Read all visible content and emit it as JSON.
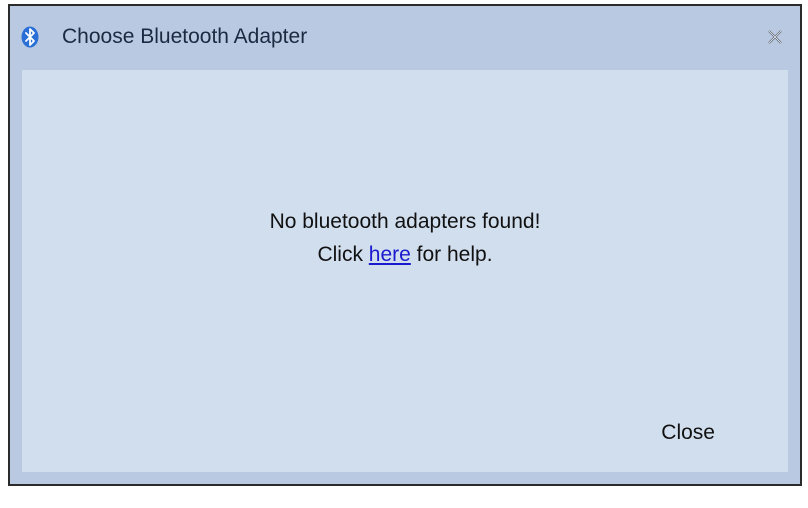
{
  "window": {
    "title": "Choose Bluetooth Adapter",
    "title_icon": "bluetooth-icon",
    "close_icon": "close-icon"
  },
  "message": {
    "line1": "No bluetooth adapters found!",
    "line2_prefix": "Click ",
    "link_text": "here",
    "line2_suffix": " for help."
  },
  "buttons": {
    "close_label": "Close"
  },
  "colors": {
    "frame": "#b9c9e2",
    "client": "#d1deee",
    "link": "#1a1acf",
    "bluetooth_icon": "#2a6fd6"
  }
}
